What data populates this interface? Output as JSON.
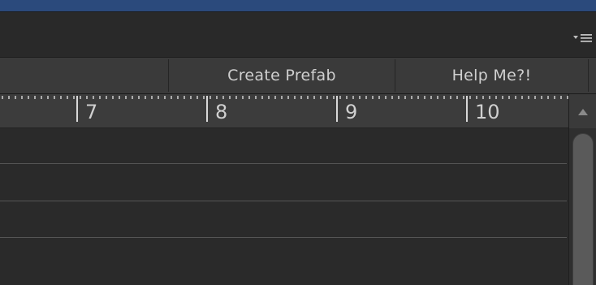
{
  "toolbar": {
    "create_prefab_label": "Create Prefab",
    "help_label": "Help Me?!"
  },
  "timeline": {
    "ticks": [
      "7",
      "8",
      "9",
      "10"
    ]
  },
  "icons": {
    "panel_menu": "dropdown-menu-icon",
    "scroll_up": "triangle-up-icon"
  },
  "colors": {
    "title_accent": "#2b4a7c",
    "background": "#2a2a2a",
    "toolbar": "#3a3a3a"
  }
}
